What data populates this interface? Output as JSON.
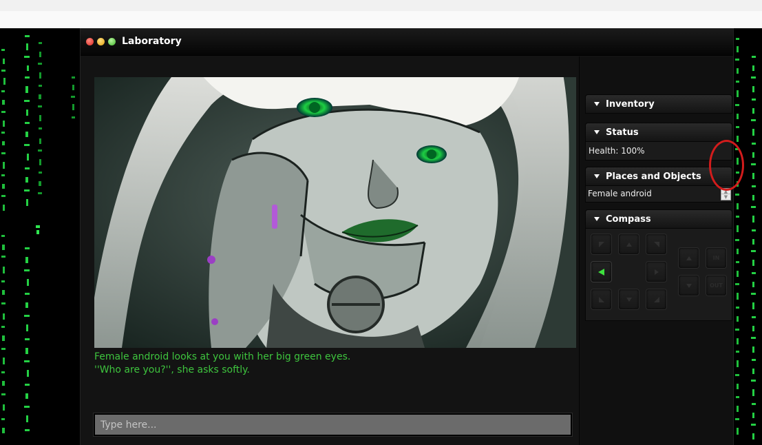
{
  "window": {
    "title": "Laboratory"
  },
  "scene": {
    "narration": [
      "Female android looks at you with her big green eyes.",
      "''Who are you?'', she asks softly."
    ]
  },
  "command": {
    "placeholder": "Type here..."
  },
  "sidebar": {
    "inventory": {
      "label": "Inventory"
    },
    "status": {
      "label": "Status",
      "health": "Health: 100%"
    },
    "places": {
      "label": "Places and Objects",
      "items": [
        "Female android"
      ]
    },
    "compass": {
      "label": "Compass",
      "in_label": "IN",
      "out_label": "OUT",
      "active_direction": "west"
    }
  },
  "colors": {
    "accent_green": "#3ec43e",
    "highlight_ring": "#d21c1c"
  }
}
